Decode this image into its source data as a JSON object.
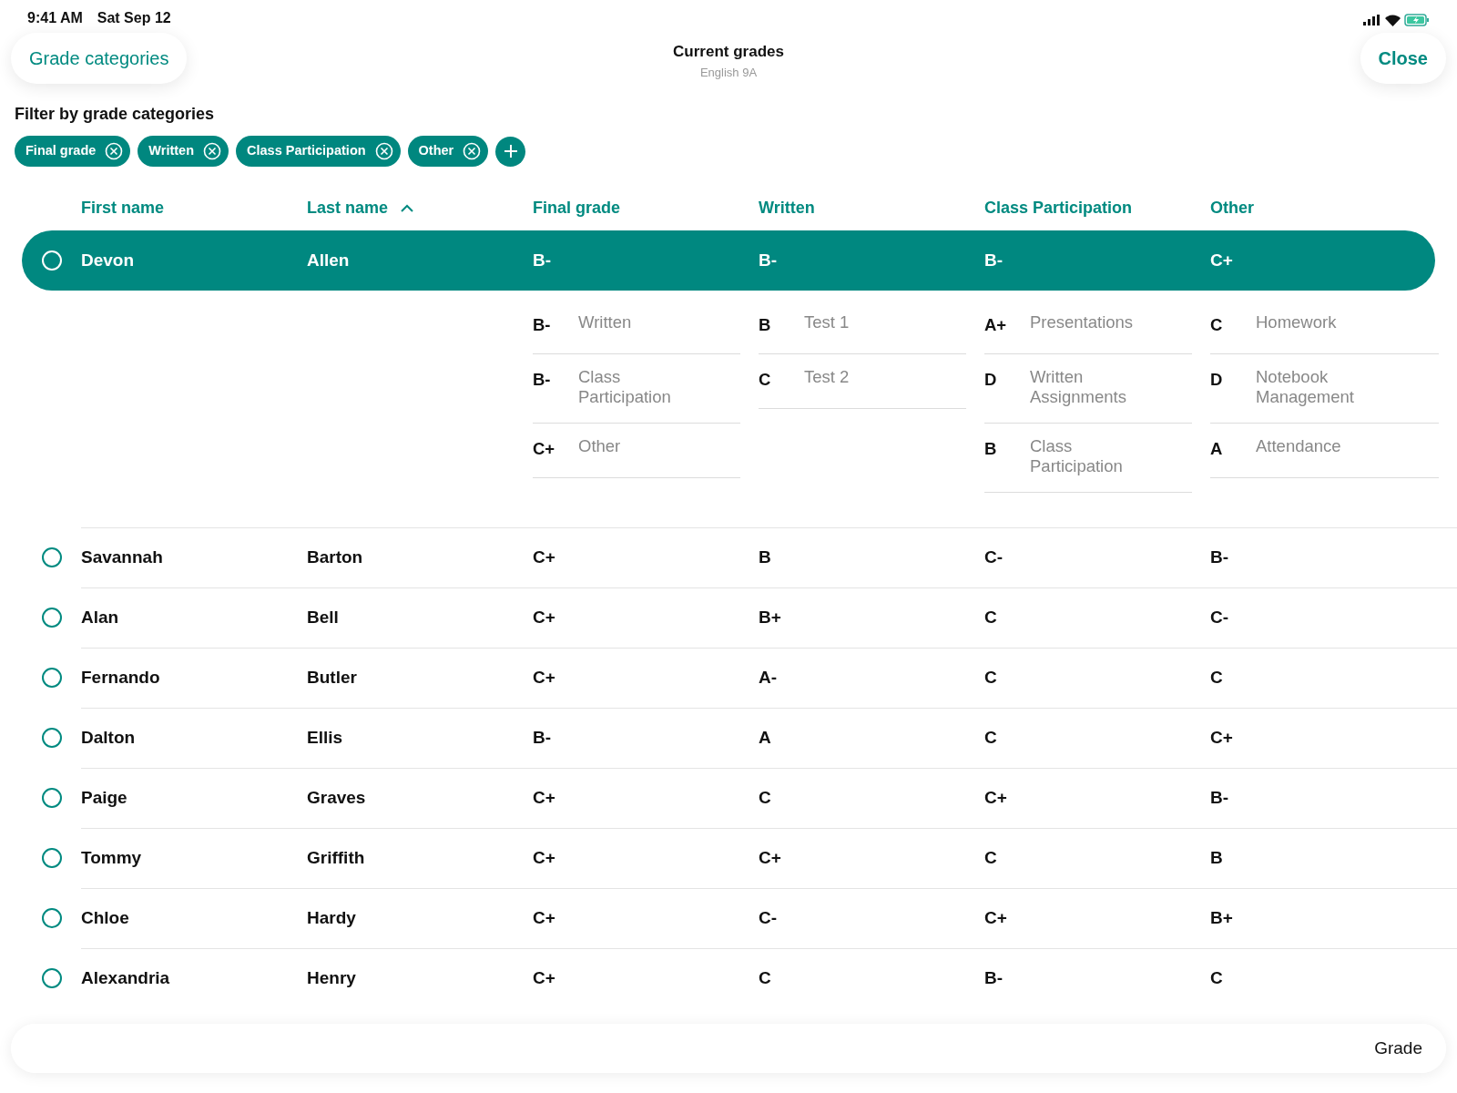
{
  "status_bar": {
    "time": "9:41 AM",
    "date": "Sat Sep 12"
  },
  "nav": {
    "left_button": "Grade categories",
    "title": "Current grades",
    "subtitle": "English 9A",
    "right_button": "Close"
  },
  "filter": {
    "label": "Filter by grade categories",
    "chips": [
      {
        "label": "Final grade"
      },
      {
        "label": "Written"
      },
      {
        "label": "Class Participation"
      },
      {
        "label": "Other"
      }
    ]
  },
  "table": {
    "columns": [
      {
        "label": "First name",
        "sorted": false
      },
      {
        "label": "Last name",
        "sorted": true
      },
      {
        "label": "Final grade",
        "sorted": false
      },
      {
        "label": "Written",
        "sorted": false
      },
      {
        "label": "Class Participation",
        "sorted": false
      },
      {
        "label": "Other",
        "sorted": false
      }
    ],
    "rows": [
      {
        "first": "Devon",
        "last": "Allen",
        "grades": [
          "B-",
          "B-",
          "B-",
          "C+"
        ],
        "selected": true,
        "breakdown": [
          [
            {
              "grade": "B-",
              "name": "Written"
            },
            {
              "grade": "B-",
              "name": "Class Participation"
            },
            {
              "grade": "C+",
              "name": "Other"
            }
          ],
          [
            {
              "grade": "B",
              "name": "Test 1"
            },
            {
              "grade": "C",
              "name": "Test 2"
            }
          ],
          [
            {
              "grade": "A+",
              "name": "Presentations"
            },
            {
              "grade": "D",
              "name": "Written Assignments"
            },
            {
              "grade": "B",
              "name": "Class Participation"
            }
          ],
          [
            {
              "grade": "C",
              "name": "Homework"
            },
            {
              "grade": "D",
              "name": "Notebook Management"
            },
            {
              "grade": "A",
              "name": "Attendance"
            }
          ]
        ]
      },
      {
        "first": "Savannah",
        "last": "Barton",
        "grades": [
          "C+",
          "B",
          "C-",
          "B-"
        ],
        "selected": false
      },
      {
        "first": "Alan",
        "last": "Bell",
        "grades": [
          "C+",
          "B+",
          "C",
          "C-"
        ],
        "selected": false
      },
      {
        "first": "Fernando",
        "last": "Butler",
        "grades": [
          "C+",
          "A-",
          "C",
          "C"
        ],
        "selected": false
      },
      {
        "first": "Dalton",
        "last": "Ellis",
        "grades": [
          "B-",
          "A",
          "C",
          "C+"
        ],
        "selected": false
      },
      {
        "first": "Paige",
        "last": "Graves",
        "grades": [
          "C+",
          "C",
          "C+",
          "B-"
        ],
        "selected": false
      },
      {
        "first": "Tommy",
        "last": "Griffith",
        "grades": [
          "C+",
          "C+",
          "C",
          "B"
        ],
        "selected": false
      },
      {
        "first": "Chloe",
        "last": "Hardy",
        "grades": [
          "C+",
          "C-",
          "C+",
          "B+"
        ],
        "selected": false
      },
      {
        "first": "Alexandria",
        "last": "Henry",
        "grades": [
          "C+",
          "C",
          "B-",
          "C"
        ],
        "selected": false
      }
    ]
  },
  "bottom_bar": {
    "button": "Grade"
  }
}
